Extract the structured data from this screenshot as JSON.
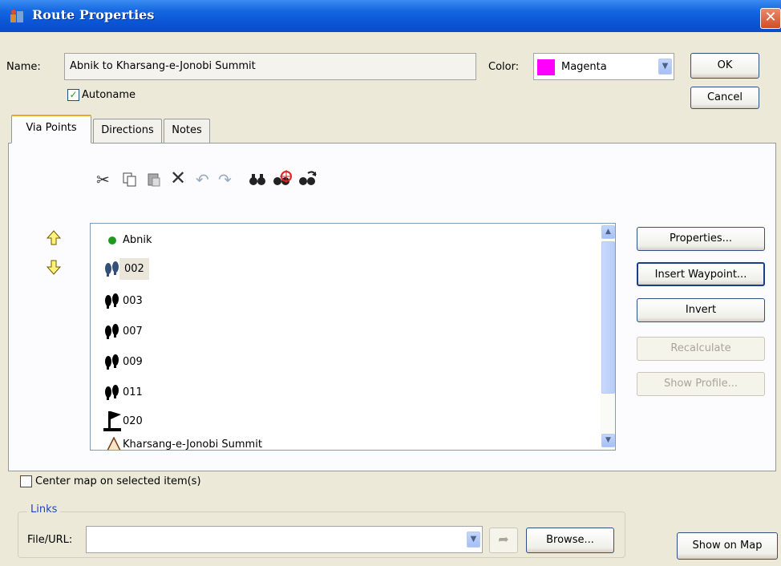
{
  "window": {
    "title": "Route Properties",
    "close_glyph": "✕"
  },
  "name_label": "Name:",
  "name_value": "Abnik to Kharsang-e-Jonobi Summit",
  "color_label": "Color:",
  "color_value": "Magenta",
  "color_swatch": "#ff00ff",
  "autoname_label": "Autoname",
  "autoname_checked": true,
  "buttons": {
    "ok": "OK",
    "cancel": "Cancel",
    "properties": "Properties...",
    "insert_waypoint": "Insert Waypoint...",
    "invert": "Invert",
    "recalculate": "Recalculate",
    "show_profile": "Show Profile...",
    "browse": "Browse...",
    "show_on_map": "Show on Map"
  },
  "tabs": [
    {
      "label": "Via Points",
      "active": true
    },
    {
      "label": "Directions",
      "active": false
    },
    {
      "label": "Notes",
      "active": false
    }
  ],
  "toolbar_icons": [
    "cut-icon",
    "copy-icon",
    "paste-icon",
    "delete-icon",
    "undo-icon",
    "redo-icon",
    "find-icon",
    "find-target-icon",
    "find-next-icon"
  ],
  "via_points": [
    {
      "label": "Abnik",
      "icon": "green-dot-icon"
    },
    {
      "label": "002",
      "icon": "footprints-icon",
      "selected": true
    },
    {
      "label": "003",
      "icon": "footprints-icon"
    },
    {
      "label": "007",
      "icon": "footprints-icon"
    },
    {
      "label": "009",
      "icon": "footprints-icon"
    },
    {
      "label": "011",
      "icon": "footprints-icon"
    },
    {
      "label": "020",
      "icon": "flag-icon"
    },
    {
      "label": "Kharsang-e-Jonobi Summit",
      "icon": "summit-icon"
    }
  ],
  "center_map_label": "Center map on selected item(s)",
  "links_title": "Links",
  "file_url_label": "File/URL:",
  "file_url_value": ""
}
